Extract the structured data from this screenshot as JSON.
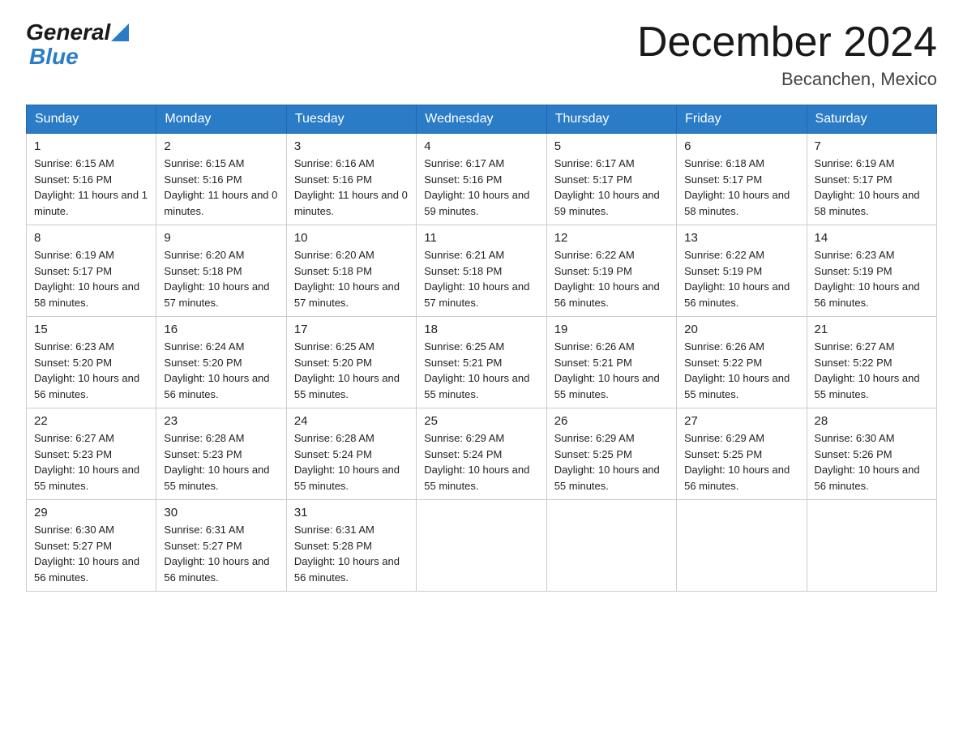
{
  "header": {
    "logo_general": "General",
    "logo_blue": "Blue",
    "title": "December 2024",
    "subtitle": "Becanchen, Mexico"
  },
  "weekdays": [
    "Sunday",
    "Monday",
    "Tuesday",
    "Wednesday",
    "Thursday",
    "Friday",
    "Saturday"
  ],
  "weeks": [
    [
      {
        "num": "1",
        "sunrise": "6:15 AM",
        "sunset": "5:16 PM",
        "daylight": "11 hours and 1 minute."
      },
      {
        "num": "2",
        "sunrise": "6:15 AM",
        "sunset": "5:16 PM",
        "daylight": "11 hours and 0 minutes."
      },
      {
        "num": "3",
        "sunrise": "6:16 AM",
        "sunset": "5:16 PM",
        "daylight": "11 hours and 0 minutes."
      },
      {
        "num": "4",
        "sunrise": "6:17 AM",
        "sunset": "5:16 PM",
        "daylight": "10 hours and 59 minutes."
      },
      {
        "num": "5",
        "sunrise": "6:17 AM",
        "sunset": "5:17 PM",
        "daylight": "10 hours and 59 minutes."
      },
      {
        "num": "6",
        "sunrise": "6:18 AM",
        "sunset": "5:17 PM",
        "daylight": "10 hours and 58 minutes."
      },
      {
        "num": "7",
        "sunrise": "6:19 AM",
        "sunset": "5:17 PM",
        "daylight": "10 hours and 58 minutes."
      }
    ],
    [
      {
        "num": "8",
        "sunrise": "6:19 AM",
        "sunset": "5:17 PM",
        "daylight": "10 hours and 58 minutes."
      },
      {
        "num": "9",
        "sunrise": "6:20 AM",
        "sunset": "5:18 PM",
        "daylight": "10 hours and 57 minutes."
      },
      {
        "num": "10",
        "sunrise": "6:20 AM",
        "sunset": "5:18 PM",
        "daylight": "10 hours and 57 minutes."
      },
      {
        "num": "11",
        "sunrise": "6:21 AM",
        "sunset": "5:18 PM",
        "daylight": "10 hours and 57 minutes."
      },
      {
        "num": "12",
        "sunrise": "6:22 AM",
        "sunset": "5:19 PM",
        "daylight": "10 hours and 56 minutes."
      },
      {
        "num": "13",
        "sunrise": "6:22 AM",
        "sunset": "5:19 PM",
        "daylight": "10 hours and 56 minutes."
      },
      {
        "num": "14",
        "sunrise": "6:23 AM",
        "sunset": "5:19 PM",
        "daylight": "10 hours and 56 minutes."
      }
    ],
    [
      {
        "num": "15",
        "sunrise": "6:23 AM",
        "sunset": "5:20 PM",
        "daylight": "10 hours and 56 minutes."
      },
      {
        "num": "16",
        "sunrise": "6:24 AM",
        "sunset": "5:20 PM",
        "daylight": "10 hours and 56 minutes."
      },
      {
        "num": "17",
        "sunrise": "6:25 AM",
        "sunset": "5:20 PM",
        "daylight": "10 hours and 55 minutes."
      },
      {
        "num": "18",
        "sunrise": "6:25 AM",
        "sunset": "5:21 PM",
        "daylight": "10 hours and 55 minutes."
      },
      {
        "num": "19",
        "sunrise": "6:26 AM",
        "sunset": "5:21 PM",
        "daylight": "10 hours and 55 minutes."
      },
      {
        "num": "20",
        "sunrise": "6:26 AM",
        "sunset": "5:22 PM",
        "daylight": "10 hours and 55 minutes."
      },
      {
        "num": "21",
        "sunrise": "6:27 AM",
        "sunset": "5:22 PM",
        "daylight": "10 hours and 55 minutes."
      }
    ],
    [
      {
        "num": "22",
        "sunrise": "6:27 AM",
        "sunset": "5:23 PM",
        "daylight": "10 hours and 55 minutes."
      },
      {
        "num": "23",
        "sunrise": "6:28 AM",
        "sunset": "5:23 PM",
        "daylight": "10 hours and 55 minutes."
      },
      {
        "num": "24",
        "sunrise": "6:28 AM",
        "sunset": "5:24 PM",
        "daylight": "10 hours and 55 minutes."
      },
      {
        "num": "25",
        "sunrise": "6:29 AM",
        "sunset": "5:24 PM",
        "daylight": "10 hours and 55 minutes."
      },
      {
        "num": "26",
        "sunrise": "6:29 AM",
        "sunset": "5:25 PM",
        "daylight": "10 hours and 55 minutes."
      },
      {
        "num": "27",
        "sunrise": "6:29 AM",
        "sunset": "5:25 PM",
        "daylight": "10 hours and 56 minutes."
      },
      {
        "num": "28",
        "sunrise": "6:30 AM",
        "sunset": "5:26 PM",
        "daylight": "10 hours and 56 minutes."
      }
    ],
    [
      {
        "num": "29",
        "sunrise": "6:30 AM",
        "sunset": "5:27 PM",
        "daylight": "10 hours and 56 minutes."
      },
      {
        "num": "30",
        "sunrise": "6:31 AM",
        "sunset": "5:27 PM",
        "daylight": "10 hours and 56 minutes."
      },
      {
        "num": "31",
        "sunrise": "6:31 AM",
        "sunset": "5:28 PM",
        "daylight": "10 hours and 56 minutes."
      },
      null,
      null,
      null,
      null
    ]
  ]
}
